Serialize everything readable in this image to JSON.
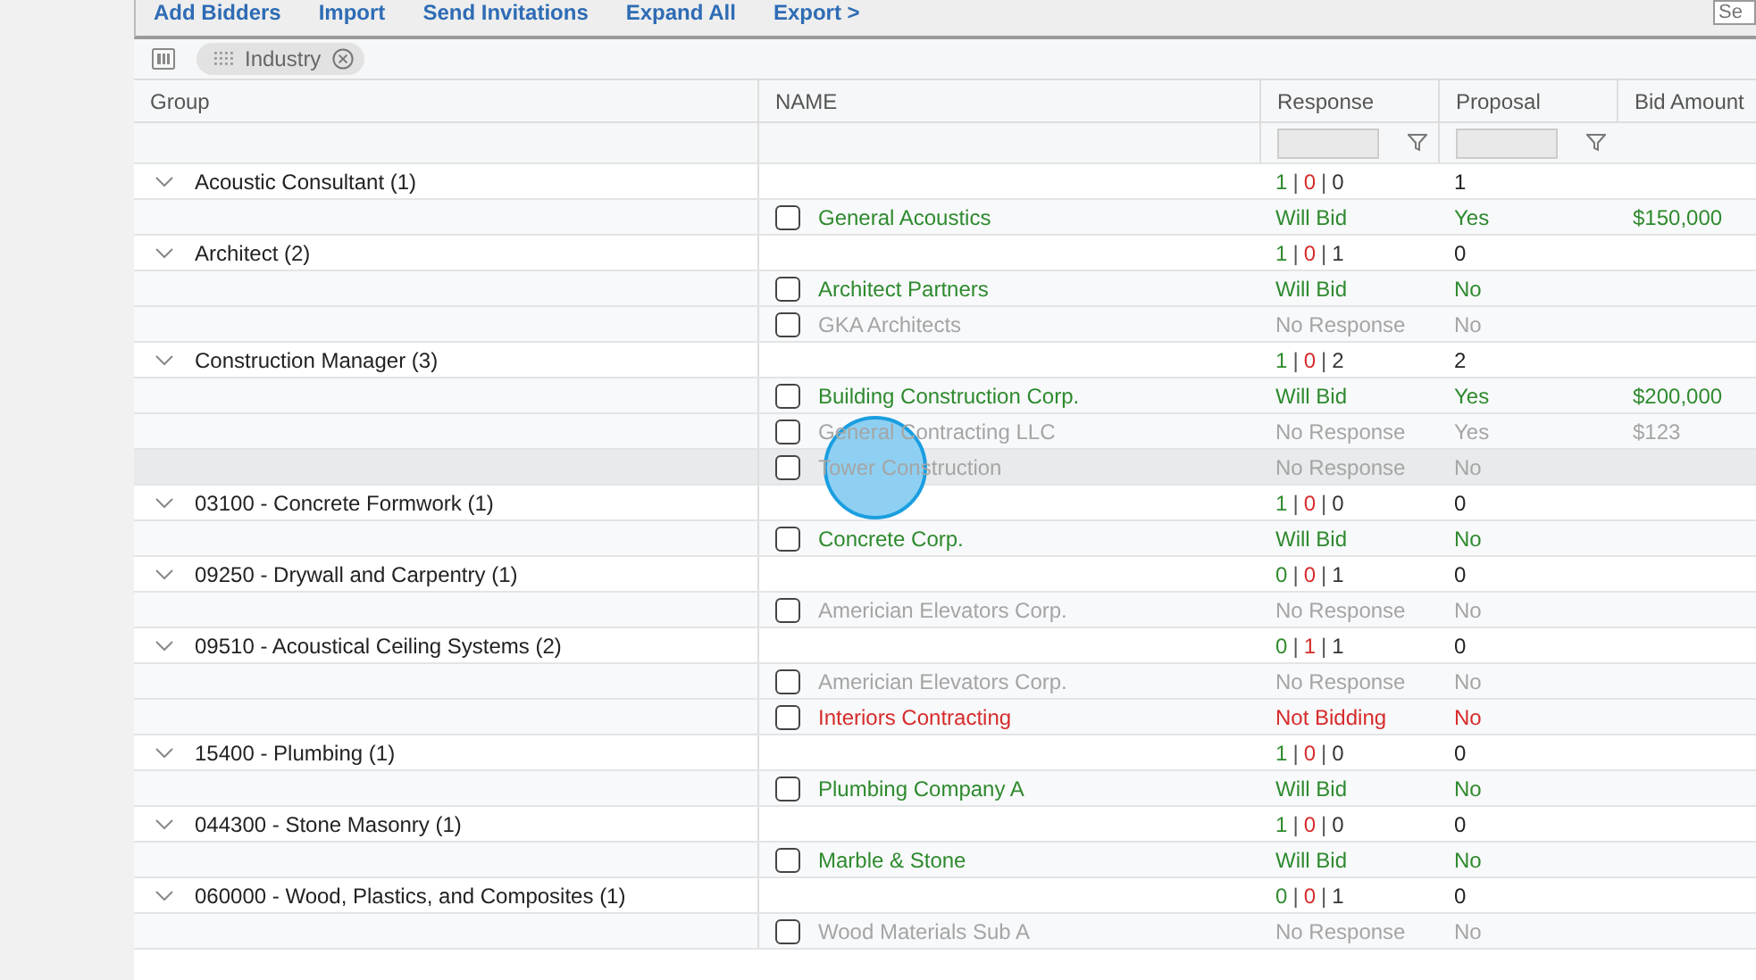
{
  "toolbar": {
    "actions": [
      "Add Bidders",
      "Import",
      "Send Invitations",
      "Expand All",
      "Export >"
    ],
    "search": {
      "placeholder": "Se"
    }
  },
  "group_by": {
    "chips": [
      "Industry"
    ]
  },
  "table": {
    "columns": [
      "Group",
      "NAME",
      "Response",
      "Proposal",
      "Bid Amount"
    ],
    "groups": [
      {
        "label": "Acoustic Consultant (1)",
        "expanded": true,
        "counts": [
          {
            "text": "1",
            "kind": "will_bid"
          },
          {
            "text": "|",
            "kind": "separator"
          },
          {
            "text": "0",
            "kind": "not_bidding"
          },
          {
            "text": "|",
            "kind": "separator"
          },
          {
            "text": "0",
            "kind": "no_response"
          }
        ],
        "proposals": "1",
        "bidders": [
          {
            "name": "General Acoustics",
            "kind": "will_bid",
            "response": "Will Bid",
            "proposal": "Yes",
            "bid_amount": "$150,000",
            "checked": false,
            "selected": false
          }
        ]
      },
      {
        "label": "Architect (2)",
        "expanded": true,
        "counts": [
          {
            "text": "1",
            "kind": "will_bid"
          },
          {
            "text": "|",
            "kind": "separator"
          },
          {
            "text": "0",
            "kind": "not_bidding"
          },
          {
            "text": "|",
            "kind": "separator"
          },
          {
            "text": "1",
            "kind": "no_response"
          }
        ],
        "proposals": "0",
        "bidders": [
          {
            "name": "Architect Partners",
            "kind": "will_bid",
            "response": "Will Bid",
            "proposal": "No",
            "checked": false,
            "selected": false
          },
          {
            "name": "GKA Architects",
            "kind": "no_response",
            "response": "No Response",
            "proposal": "No",
            "checked": false,
            "selected": false
          }
        ]
      },
      {
        "label": "Construction Manager (3)",
        "expanded": true,
        "counts": [
          {
            "text": "1",
            "kind": "will_bid"
          },
          {
            "text": "|",
            "kind": "separator"
          },
          {
            "text": "0",
            "kind": "not_bidding"
          },
          {
            "text": "|",
            "kind": "separator"
          },
          {
            "text": "2",
            "kind": "no_response"
          }
        ],
        "proposals": "2",
        "bidders": [
          {
            "name": "Building Construction Corp.",
            "kind": "will_bid",
            "response": "Will Bid",
            "proposal": "Yes",
            "bid_amount": "$200,000",
            "checked": false,
            "selected": false
          },
          {
            "name": "General Contracting LLC",
            "kind": "no_response",
            "response": "No Response",
            "proposal": "Yes",
            "bid_amount": "$123",
            "checked": false,
            "selected": false
          },
          {
            "name": "Tower Construction",
            "kind": "no_response",
            "response": "No Response",
            "proposal": "No",
            "checked": false,
            "selected": true
          }
        ]
      },
      {
        "label": "03100 - Concrete Formwork (1)",
        "expanded": true,
        "counts": [
          {
            "text": "1",
            "kind": "will_bid"
          },
          {
            "text": "|",
            "kind": "separator"
          },
          {
            "text": "0",
            "kind": "not_bidding"
          },
          {
            "text": "|",
            "kind": "separator"
          },
          {
            "text": "0",
            "kind": "no_response"
          }
        ],
        "proposals": "0",
        "bidders": [
          {
            "name": "Concrete Corp.",
            "kind": "will_bid",
            "response": "Will Bid",
            "proposal": "No",
            "checked": false,
            "selected": false
          }
        ]
      },
      {
        "label": "09250 - Drywall and Carpentry (1)",
        "expanded": true,
        "counts": [
          {
            "text": "0",
            "kind": "will_bid"
          },
          {
            "text": "|",
            "kind": "separator"
          },
          {
            "text": "0",
            "kind": "not_bidding"
          },
          {
            "text": "|",
            "kind": "separator"
          },
          {
            "text": "1",
            "kind": "no_response"
          }
        ],
        "proposals": "0",
        "bidders": [
          {
            "name": "Americian Elevators Corp.",
            "kind": "no_response",
            "response": "No Response",
            "proposal": "No",
            "checked": false,
            "selected": false
          }
        ]
      },
      {
        "label": "09510 - Acoustical Ceiling Systems (2)",
        "expanded": true,
        "counts": [
          {
            "text": "0",
            "kind": "will_bid"
          },
          {
            "text": "|",
            "kind": "separator"
          },
          {
            "text": "1",
            "kind": "not_bidding"
          },
          {
            "text": "|",
            "kind": "separator"
          },
          {
            "text": "1",
            "kind": "no_response"
          }
        ],
        "proposals": "0",
        "bidders": [
          {
            "name": "Americian Elevators Corp.",
            "kind": "no_response",
            "response": "No Response",
            "proposal": "No",
            "checked": false,
            "selected": false
          },
          {
            "name": "Interiors Contracting",
            "kind": "not_bidding",
            "response": "Not Bidding",
            "proposal": "No",
            "checked": false,
            "selected": false
          }
        ]
      },
      {
        "label": "15400 - Plumbing (1)",
        "expanded": true,
        "counts": [
          {
            "text": "1",
            "kind": "will_bid"
          },
          {
            "text": "|",
            "kind": "separator"
          },
          {
            "text": "0",
            "kind": "not_bidding"
          },
          {
            "text": "|",
            "kind": "separator"
          },
          {
            "text": "0",
            "kind": "no_response"
          }
        ],
        "proposals": "0",
        "bidders": [
          {
            "name": "Plumbing Company A",
            "kind": "will_bid",
            "response": "Will Bid",
            "proposal": "No",
            "checked": false,
            "selected": false
          }
        ]
      },
      {
        "label": "044300 - Stone Masonry (1)",
        "expanded": true,
        "counts": [
          {
            "text": "1",
            "kind": "will_bid"
          },
          {
            "text": "|",
            "kind": "separator"
          },
          {
            "text": "0",
            "kind": "not_bidding"
          },
          {
            "text": "|",
            "kind": "separator"
          },
          {
            "text": "0",
            "kind": "no_response"
          }
        ],
        "proposals": "0",
        "bidders": [
          {
            "name": "Marble & Stone",
            "kind": "will_bid",
            "response": "Will Bid",
            "proposal": "No",
            "checked": false,
            "selected": false
          }
        ]
      },
      {
        "label": "060000 - Wood, Plastics, and Composites (1)",
        "expanded": true,
        "counts": [
          {
            "text": "0",
            "kind": "will_bid"
          },
          {
            "text": "|",
            "kind": "separator"
          },
          {
            "text": "0",
            "kind": "not_bidding"
          },
          {
            "text": "|",
            "kind": "separator"
          },
          {
            "text": "1",
            "kind": "no_response"
          }
        ],
        "proposals": "0",
        "bidders": [
          {
            "name": "Wood Materials Sub A",
            "kind": "no_response",
            "response": "No Response",
            "proposal": "No",
            "checked": false,
            "selected": false
          }
        ]
      }
    ]
  }
}
